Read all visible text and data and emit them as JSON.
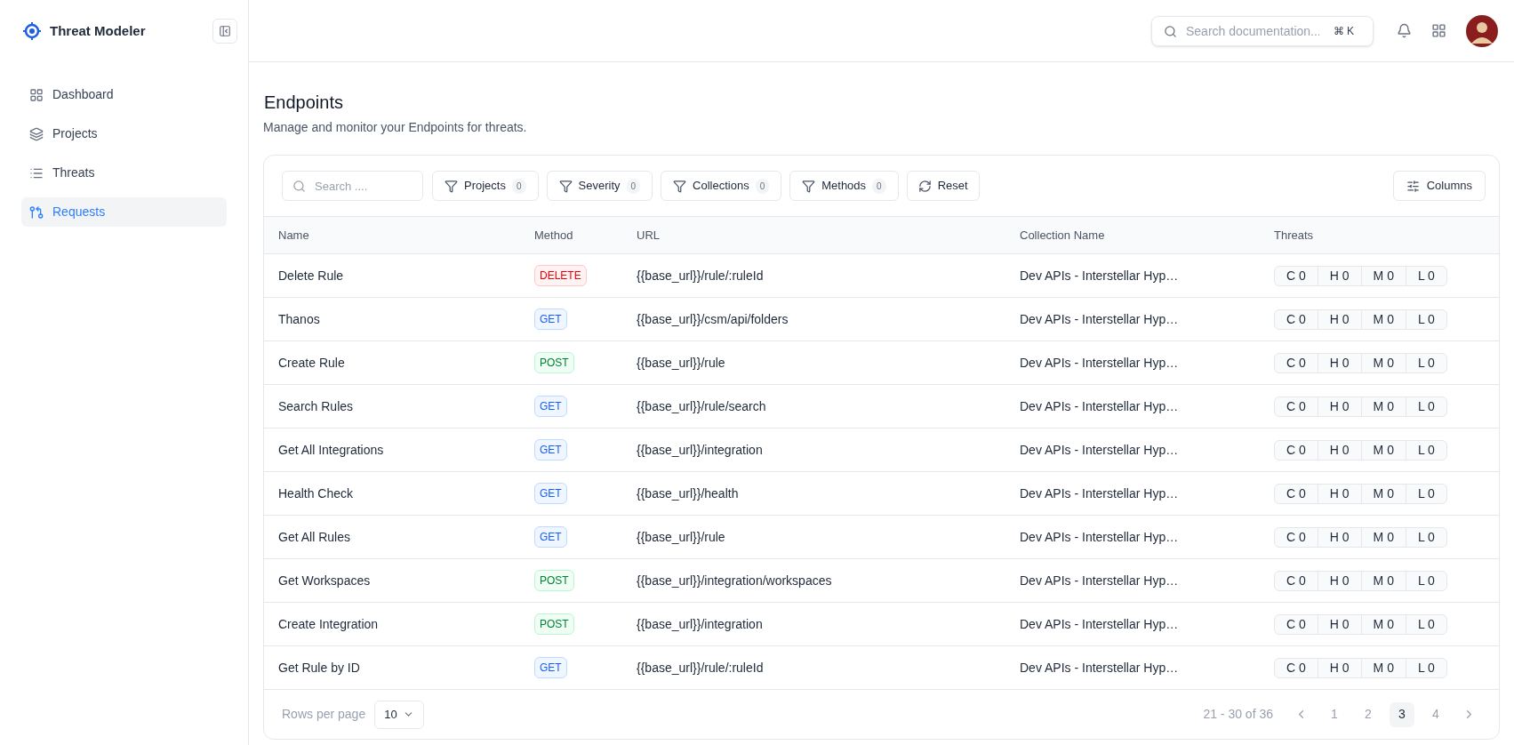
{
  "app": {
    "name": "Threat Modeler"
  },
  "sidebar": {
    "items": [
      {
        "label": "Dashboard",
        "kind": "grid",
        "selected": false
      },
      {
        "label": "Projects",
        "kind": "layers",
        "selected": false
      },
      {
        "label": "Threats",
        "kind": "list",
        "selected": false
      },
      {
        "label": "Requests",
        "kind": "requests",
        "selected": true
      }
    ]
  },
  "header": {
    "search": {
      "placeholder": "Search documentation...",
      "shortcut": "⌘ K"
    }
  },
  "page": {
    "title": "Endpoints",
    "subtitle": "Manage and monitor your Endpoints for threats."
  },
  "toolbar": {
    "search": {
      "placeholder": "Search ...."
    },
    "filters": [
      {
        "label": "Projects",
        "count": "0"
      },
      {
        "label": "Severity",
        "count": "0"
      },
      {
        "label": "Collections",
        "count": "0"
      },
      {
        "label": "Methods",
        "count": "0"
      }
    ],
    "reset": "Reset",
    "columns": "Columns"
  },
  "table": {
    "columns": [
      "Name",
      "Method",
      "URL",
      "Collection Name",
      "Threats"
    ],
    "rows": [
      {
        "name": "Delete Rule",
        "method": "DELETE",
        "kind": "delete",
        "url": "{{base_url}}/rule/:ruleId",
        "collection": "Dev APIs - Interstellar Hyp…",
        "threats": [
          "C 0",
          "H 0",
          "M 0",
          "L 0"
        ]
      },
      {
        "name": "Thanos",
        "method": "GET",
        "kind": "get",
        "url": "{{base_url}}/csm/api/folders",
        "collection": "Dev APIs - Interstellar Hyp…",
        "threats": [
          "C 0",
          "H 0",
          "M 0",
          "L 0"
        ]
      },
      {
        "name": "Create Rule",
        "method": "POST",
        "kind": "post",
        "url": "{{base_url}}/rule",
        "collection": "Dev APIs - Interstellar Hyp…",
        "threats": [
          "C 0",
          "H 0",
          "M 0",
          "L 0"
        ]
      },
      {
        "name": "Search Rules",
        "method": "GET",
        "kind": "get",
        "url": "{{base_url}}/rule/search",
        "collection": "Dev APIs - Interstellar Hyp…",
        "threats": [
          "C 0",
          "H 0",
          "M 0",
          "L 0"
        ]
      },
      {
        "name": "Get All Integrations",
        "method": "GET",
        "kind": "get",
        "url": "{{base_url}}/integration",
        "collection": "Dev APIs - Interstellar Hyp…",
        "threats": [
          "C 0",
          "H 0",
          "M 0",
          "L 0"
        ]
      },
      {
        "name": "Health Check",
        "method": "GET",
        "kind": "get",
        "url": "{{base_url}}/health",
        "collection": "Dev APIs - Interstellar Hyp…",
        "threats": [
          "C 0",
          "H 0",
          "M 0",
          "L 0"
        ]
      },
      {
        "name": "Get All Rules",
        "method": "GET",
        "kind": "get",
        "url": "{{base_url}}/rule",
        "collection": "Dev APIs - Interstellar Hyp…",
        "threats": [
          "C 0",
          "H 0",
          "M 0",
          "L 0"
        ]
      },
      {
        "name": "Get Workspaces",
        "method": "POST",
        "kind": "post",
        "url": "{{base_url}}/integration/workspaces",
        "collection": "Dev APIs - Interstellar Hyp…",
        "threats": [
          "C 0",
          "H 0",
          "M 0",
          "L 0"
        ]
      },
      {
        "name": "Create Integration",
        "method": "POST",
        "kind": "post",
        "url": "{{base_url}}/integration",
        "collection": "Dev APIs - Interstellar Hyp…",
        "threats": [
          "C 0",
          "H 0",
          "M 0",
          "L 0"
        ]
      },
      {
        "name": "Get Rule by ID",
        "method": "GET",
        "kind": "get",
        "url": "{{base_url}}/rule/:ruleId",
        "collection": "Dev APIs - Interstellar Hyp…",
        "threats": [
          "C 0",
          "H 0",
          "M 0",
          "L 0"
        ]
      }
    ]
  },
  "footer": {
    "rows_per_page_label": "Rows per page",
    "rows_per_page": "10",
    "range": "21 - 30 of 36",
    "pages": [
      {
        "label": "1",
        "selected": false
      },
      {
        "label": "2",
        "selected": false
      },
      {
        "label": "3",
        "selected": true
      },
      {
        "label": "4",
        "selected": false
      }
    ]
  }
}
